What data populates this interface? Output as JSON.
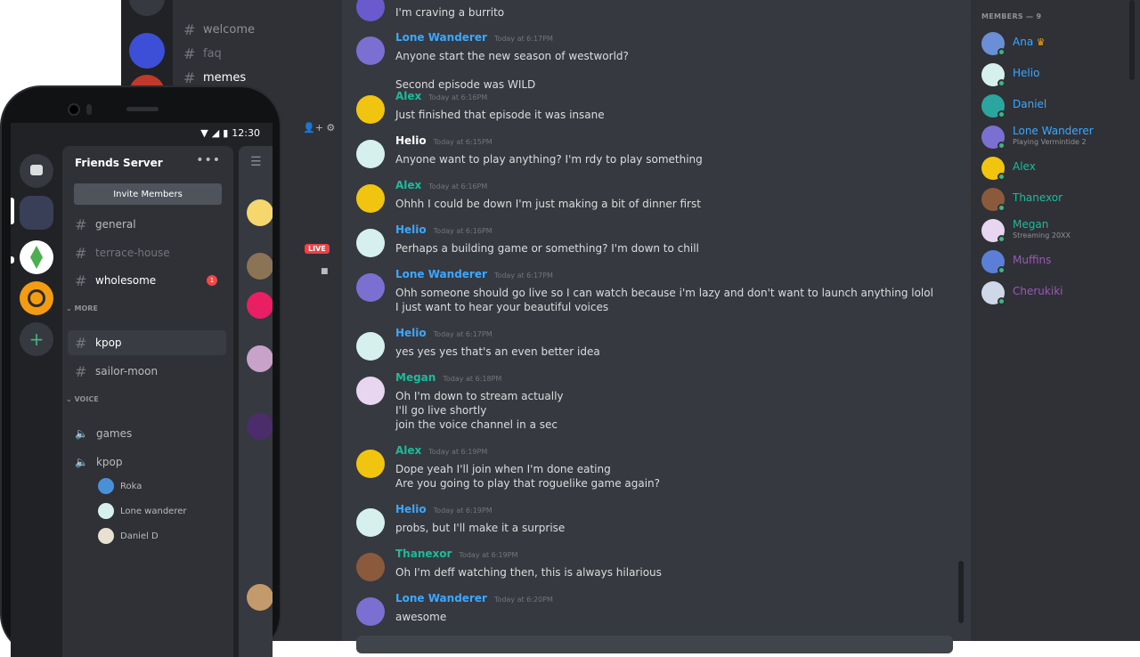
{
  "desktop": {
    "channels": [
      {
        "name": "welcome",
        "state": "normal"
      },
      {
        "name": "faq",
        "state": "muted"
      },
      {
        "name": "memes",
        "state": "active"
      }
    ],
    "messages": [
      {
        "author": "",
        "color": "",
        "time": "",
        "avatar": "#6a5acd",
        "lines": [
          "I'm craving a burrito"
        ]
      },
      {
        "author": "Lone Wanderer",
        "color": "#3ba8ff",
        "time": "Today at 6:17PM",
        "avatar": "#7b6fd1",
        "lines": [
          "Anyone start the new season of westworld?",
          "",
          "Second episode was WILD"
        ]
      },
      {
        "author": "Alex",
        "color": "#1abc9c",
        "time": "Today at 6:16PM",
        "avatar": "#f1c40f",
        "lines": [
          "Just finished that episode it was insane"
        ]
      },
      {
        "author": "Helio",
        "color": "#ffffff",
        "time": "Today at 6:15PM",
        "avatar": "#d6f0ee",
        "lines": [
          "Anyone want to play anything? I'm rdy to play something"
        ]
      },
      {
        "author": "Alex",
        "color": "#1abc9c",
        "time": "Today at 6:16PM",
        "avatar": "#f1c40f",
        "lines": [
          "Ohhh I could be down I'm just making a bit of dinner first"
        ]
      },
      {
        "author": "Helio",
        "color": "#3ba8ff",
        "time": "Today at 6:16PM",
        "avatar": "#d6f0ee",
        "lines": [
          "Perhaps a building game or something? I'm down to chill"
        ]
      },
      {
        "author": "Lone Wanderer",
        "color": "#3ba8ff",
        "time": "Today at 6:17PM",
        "avatar": "#7b6fd1",
        "lines": [
          "Ohh someone should go live so I can watch because i'm lazy and don't want to launch anything lolol",
          "I just want to hear your beautiful voices"
        ]
      },
      {
        "author": "Helio",
        "color": "#3ba8ff",
        "time": "Today at 6:17PM",
        "avatar": "#d6f0ee",
        "lines": [
          "yes yes yes that's an even better idea"
        ]
      },
      {
        "author": "Megan",
        "color": "#1abc9c",
        "time": "Today at 6:18PM",
        "avatar": "#e8d5f0",
        "lines": [
          "Oh I'm down to stream actually",
          "I'll go live shortly",
          "join the voice channel in a sec"
        ]
      },
      {
        "author": "Alex",
        "color": "#1abc9c",
        "time": "Today at 6:19PM",
        "avatar": "#f1c40f",
        "lines": [
          "Dope yeah I'll join when I'm done eating",
          "Are you going to play that roguelike game again?"
        ]
      },
      {
        "author": "Helio",
        "color": "#3ba8ff",
        "time": "Today at 6:19PM",
        "avatar": "#d6f0ee",
        "lines": [
          "probs, but I'll make it a surprise"
        ]
      },
      {
        "author": "Thanexor",
        "color": "#1abc9c",
        "time": "Today at 6:19PM",
        "avatar": "#8b5a3c",
        "lines": [
          "Oh I'm deff watching then, this is always hilarious"
        ]
      },
      {
        "author": "Lone Wanderer",
        "color": "#3ba8ff",
        "time": "Today at 6:20PM",
        "avatar": "#7b6fd1",
        "lines": [
          "awesome"
        ]
      }
    ],
    "members_header": "MEMBERS — 9",
    "members": [
      {
        "name": "Ana",
        "color": "#3ba8ff",
        "activity": "",
        "avatar": "#6b8fd6",
        "crown": true
      },
      {
        "name": "Helio",
        "color": "#3ba8ff",
        "activity": "",
        "avatar": "#d6f0ee",
        "crown": false
      },
      {
        "name": "Daniel",
        "color": "#3ba8ff",
        "activity": "",
        "avatar": "#2aa5a0",
        "crown": false
      },
      {
        "name": "Lone Wanderer",
        "color": "#3ba8ff",
        "activity": "Playing Vermintide 2",
        "avatar": "#7b6fd1",
        "crown": false
      },
      {
        "name": "Alex",
        "color": "#1abc9c",
        "activity": "",
        "avatar": "#f1c40f",
        "crown": false
      },
      {
        "name": "Thanexor",
        "color": "#1abc9c",
        "activity": "",
        "avatar": "#8b5a3c",
        "crown": false
      },
      {
        "name": "Megan",
        "color": "#1abc9c",
        "activity": "Streaming 20XX",
        "avatar": "#e8d5f0",
        "crown": false
      },
      {
        "name": "Muffins",
        "color": "#9b59b6",
        "activity": "",
        "avatar": "#5b7fd6",
        "crown": false
      },
      {
        "name": "Cherukiki",
        "color": "#9b59b6",
        "activity": "",
        "avatar": "#cfd8e8",
        "crown": false
      }
    ],
    "live_label": "LIVE"
  },
  "phone": {
    "time": "12:30",
    "server_name": "Friends Server",
    "more_label": "•••",
    "invite_label": "Invite Members",
    "menu_label": "☰",
    "text_channels": [
      {
        "name": "general",
        "state": "normal"
      },
      {
        "name": "terrace-house",
        "state": "muted"
      },
      {
        "name": "wholesome",
        "state": "unread",
        "badge": "1"
      }
    ],
    "more_category": "MORE",
    "more_channels": [
      {
        "name": "kpop",
        "state": "selected"
      },
      {
        "name": "sailor-moon",
        "state": "normal"
      }
    ],
    "voice_category": "VOICE",
    "voice_channels": [
      {
        "name": "games"
      },
      {
        "name": "kpop"
      }
    ],
    "voice_users": [
      {
        "name": "Roka",
        "avatar": "#4a90d9"
      },
      {
        "name": "Lone wanderer",
        "avatar": "#d6f0ee"
      },
      {
        "name": "Daniel D",
        "avatar": "#e8e0d0"
      }
    ]
  }
}
